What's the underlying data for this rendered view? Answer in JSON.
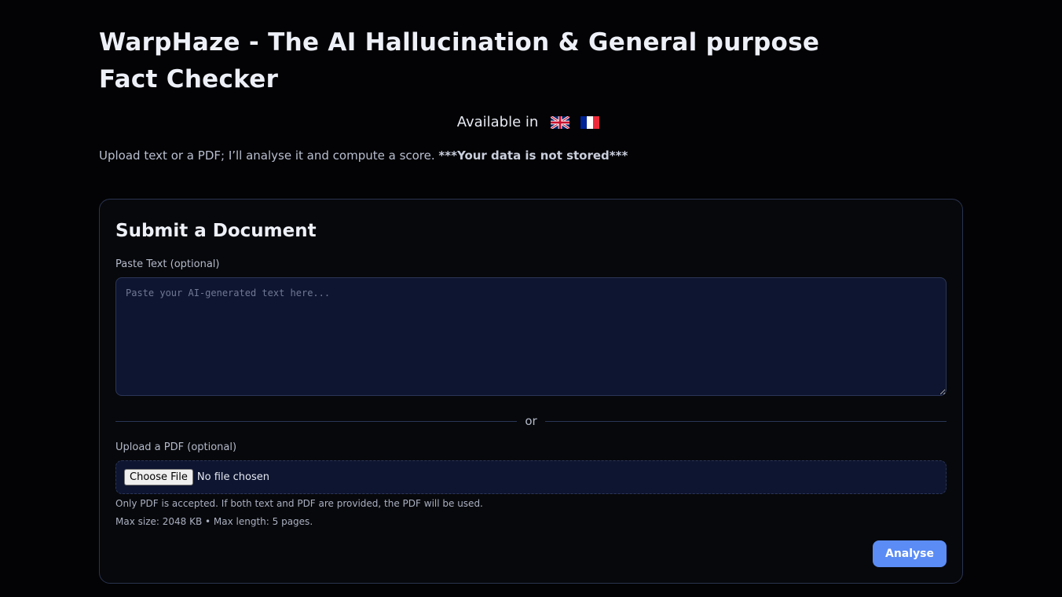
{
  "header": {
    "title": "WarpHaze - The AI Hallucination & General purpose Fact Checker",
    "available_label": "Available in",
    "languages": [
      {
        "code": "en",
        "icon": "uk-flag-icon"
      },
      {
        "code": "fr",
        "icon": "france-flag-icon"
      }
    ],
    "intro_text": "Upload text or a PDF; I’ll analyse it and compute a score. ",
    "intro_emphasis": "***Your data is not stored***"
  },
  "form": {
    "title": "Submit a Document",
    "text_label": "Paste Text (optional)",
    "text_placeholder": "Paste your AI-generated text here...",
    "text_value": "",
    "divider_text": "or",
    "pdf_label": "Upload a PDF (optional)",
    "choose_file_label": "Choose File",
    "file_status": "No file chosen",
    "help_line_1": "Only PDF is accepted. If both text and PDF are provided, the PDF will be used.",
    "help_line_2": "Max size: 2048 KB • Max length: 5 pages.",
    "submit_label": "Analyse"
  },
  "colors": {
    "background": "#030305",
    "card": "#07080b",
    "input_bg": "#0e1530",
    "border": "#2b3658",
    "accent": "#5b8cf5"
  }
}
